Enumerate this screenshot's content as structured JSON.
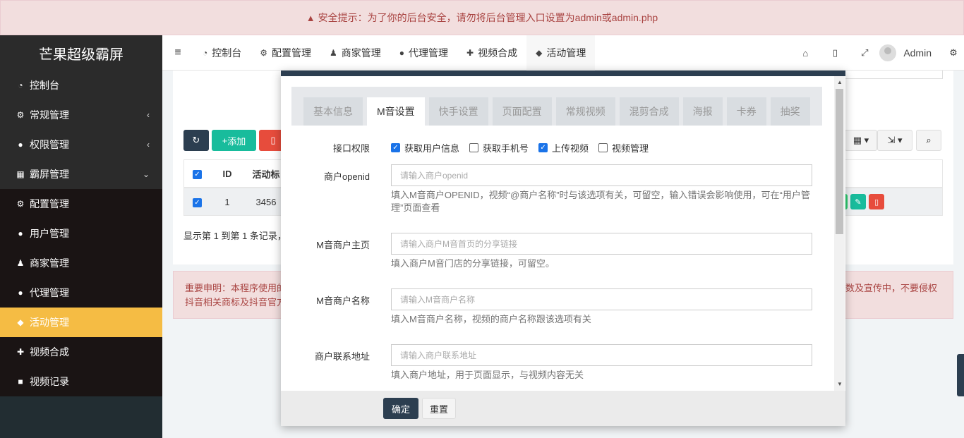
{
  "alert": {
    "icon": "warning-icon",
    "text": "安全提示：为了你的后台安全，请勿将后台管理入口设置为admin或admin.php"
  },
  "brand": "芒果超级霸屏",
  "sidebar": {
    "items": [
      {
        "label": "控制台",
        "icon": "dashboard-icon"
      },
      {
        "label": "常规管理",
        "icon": "cogs-icon"
      },
      {
        "label": "权限管理",
        "icon": "users-icon"
      },
      {
        "label": "霸屏管理",
        "icon": "grid-icon"
      }
    ],
    "sub": [
      {
        "label": "配置管理",
        "icon": "gear-icon"
      },
      {
        "label": "用户管理",
        "icon": "user-icon"
      },
      {
        "label": "商家管理",
        "icon": "shop-icon"
      },
      {
        "label": "代理管理",
        "icon": "users-icon"
      },
      {
        "label": "活动管理",
        "icon": "tag-icon"
      },
      {
        "label": "视频合成",
        "icon": "puzzle-icon"
      },
      {
        "label": "视频记录",
        "icon": "video-icon"
      }
    ]
  },
  "navbar": {
    "tabs": [
      {
        "label": "控制台",
        "icon": "dashboard-icon"
      },
      {
        "label": "配置管理",
        "icon": "gear-icon"
      },
      {
        "label": "商家管理",
        "icon": "shop-icon"
      },
      {
        "label": "代理管理",
        "icon": "users-icon"
      },
      {
        "label": "视频合成",
        "icon": "puzzle-icon"
      },
      {
        "label": "活动管理",
        "icon": "tag-icon"
      }
    ],
    "user": "Admin"
  },
  "background": {
    "add_label": "添加",
    "table": {
      "id_header": "ID",
      "title_header": "活动标",
      "row_id": "1",
      "row_title": "3456"
    },
    "page_info": "显示第 1 到第 1 条记录，",
    "notice_left_1": "重要申明：本程序使用的",
    "notice_left_2": "抖音相关商标及抖音官方",
    "notice_right": "数及宣传中，不要侵权"
  },
  "modal": {
    "tabs": [
      "基本信息",
      "M音设置",
      "快手设置",
      "页面配置",
      "常规视频",
      "混剪合成",
      "海报",
      "卡券",
      "抽奖"
    ],
    "active_tab": 1,
    "permission": {
      "label": "接口权限",
      "options": [
        {
          "label": "获取用户信息",
          "checked": true
        },
        {
          "label": "获取手机号",
          "checked": false
        },
        {
          "label": "上传视频",
          "checked": true
        },
        {
          "label": "视频管理",
          "checked": false
        }
      ]
    },
    "fields": [
      {
        "label": "商户openid",
        "placeholder": "请输入商户openid",
        "help": "填入M音商户OPENID，视频“@商户名称”时与该选项有关，可留空，输入错误会影响使用，可在“用户管理”页面查看"
      },
      {
        "label": "M音商户主页",
        "placeholder": "请输入商户M音首页的分享链接",
        "help": "填入商户M音门店的分享链接，可留空。"
      },
      {
        "label": "M音商户名称",
        "placeholder": "请输入M音商户名称",
        "help": "填入M音商户名称，视频的商户名称跟该选项有关"
      },
      {
        "label": "商户联系地址",
        "placeholder": "请输入商户联系地址",
        "help": "填入商户地址，用于页面显示，与视频内容无关"
      }
    ],
    "ok_label": "确定",
    "reset_label": "重置"
  }
}
